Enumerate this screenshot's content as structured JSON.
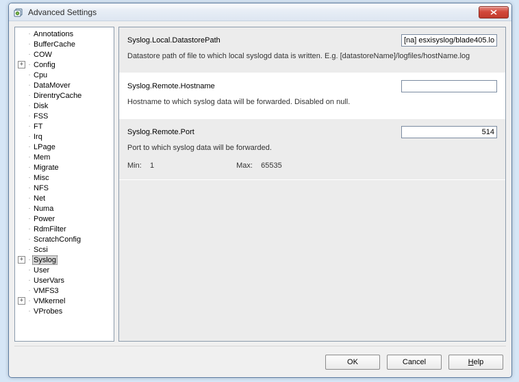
{
  "window": {
    "title": "Advanced Settings"
  },
  "tree": {
    "items": [
      {
        "label": "Annotations",
        "expand": null
      },
      {
        "label": "BufferCache",
        "expand": null
      },
      {
        "label": "COW",
        "expand": null
      },
      {
        "label": "Config",
        "expand": "plus"
      },
      {
        "label": "Cpu",
        "expand": null
      },
      {
        "label": "DataMover",
        "expand": null
      },
      {
        "label": "DirentryCache",
        "expand": null
      },
      {
        "label": "Disk",
        "expand": null
      },
      {
        "label": "FSS",
        "expand": null
      },
      {
        "label": "FT",
        "expand": null
      },
      {
        "label": "Irq",
        "expand": null
      },
      {
        "label": "LPage",
        "expand": null
      },
      {
        "label": "Mem",
        "expand": null
      },
      {
        "label": "Migrate",
        "expand": null
      },
      {
        "label": "Misc",
        "expand": null
      },
      {
        "label": "NFS",
        "expand": null
      },
      {
        "label": "Net",
        "expand": null
      },
      {
        "label": "Numa",
        "expand": null
      },
      {
        "label": "Power",
        "expand": null
      },
      {
        "label": "RdmFilter",
        "expand": null
      },
      {
        "label": "ScratchConfig",
        "expand": null
      },
      {
        "label": "Scsi",
        "expand": null
      },
      {
        "label": "Syslog",
        "expand": "plus",
        "selected": true
      },
      {
        "label": "User",
        "expand": null
      },
      {
        "label": "UserVars",
        "expand": null
      },
      {
        "label": "VMFS3",
        "expand": null
      },
      {
        "label": "VMkernel",
        "expand": "plus"
      },
      {
        "label": "VProbes",
        "expand": null
      }
    ]
  },
  "settings": [
    {
      "key": "Syslog.Local.DatastorePath",
      "value": "[na] esxisyslog/blade405.lo",
      "desc": "Datastore path of file to which local syslogd data is written. E.g. [datastoreName]/logfiles/hostName.log",
      "align": "left"
    },
    {
      "key": "Syslog.Remote.Hostname",
      "value": "",
      "desc": "Hostname to which syslog data will be forwarded. Disabled on null.",
      "align": "left"
    },
    {
      "key": "Syslog.Remote.Port",
      "value": "514",
      "desc": "Port to which syslog data will be forwarded.",
      "align": "right",
      "min_label": "Min:",
      "min_value": "1",
      "max_label": "Max:",
      "max_value": "65535"
    }
  ],
  "footer": {
    "ok": "OK",
    "cancel": "Cancel",
    "help": "Help"
  }
}
